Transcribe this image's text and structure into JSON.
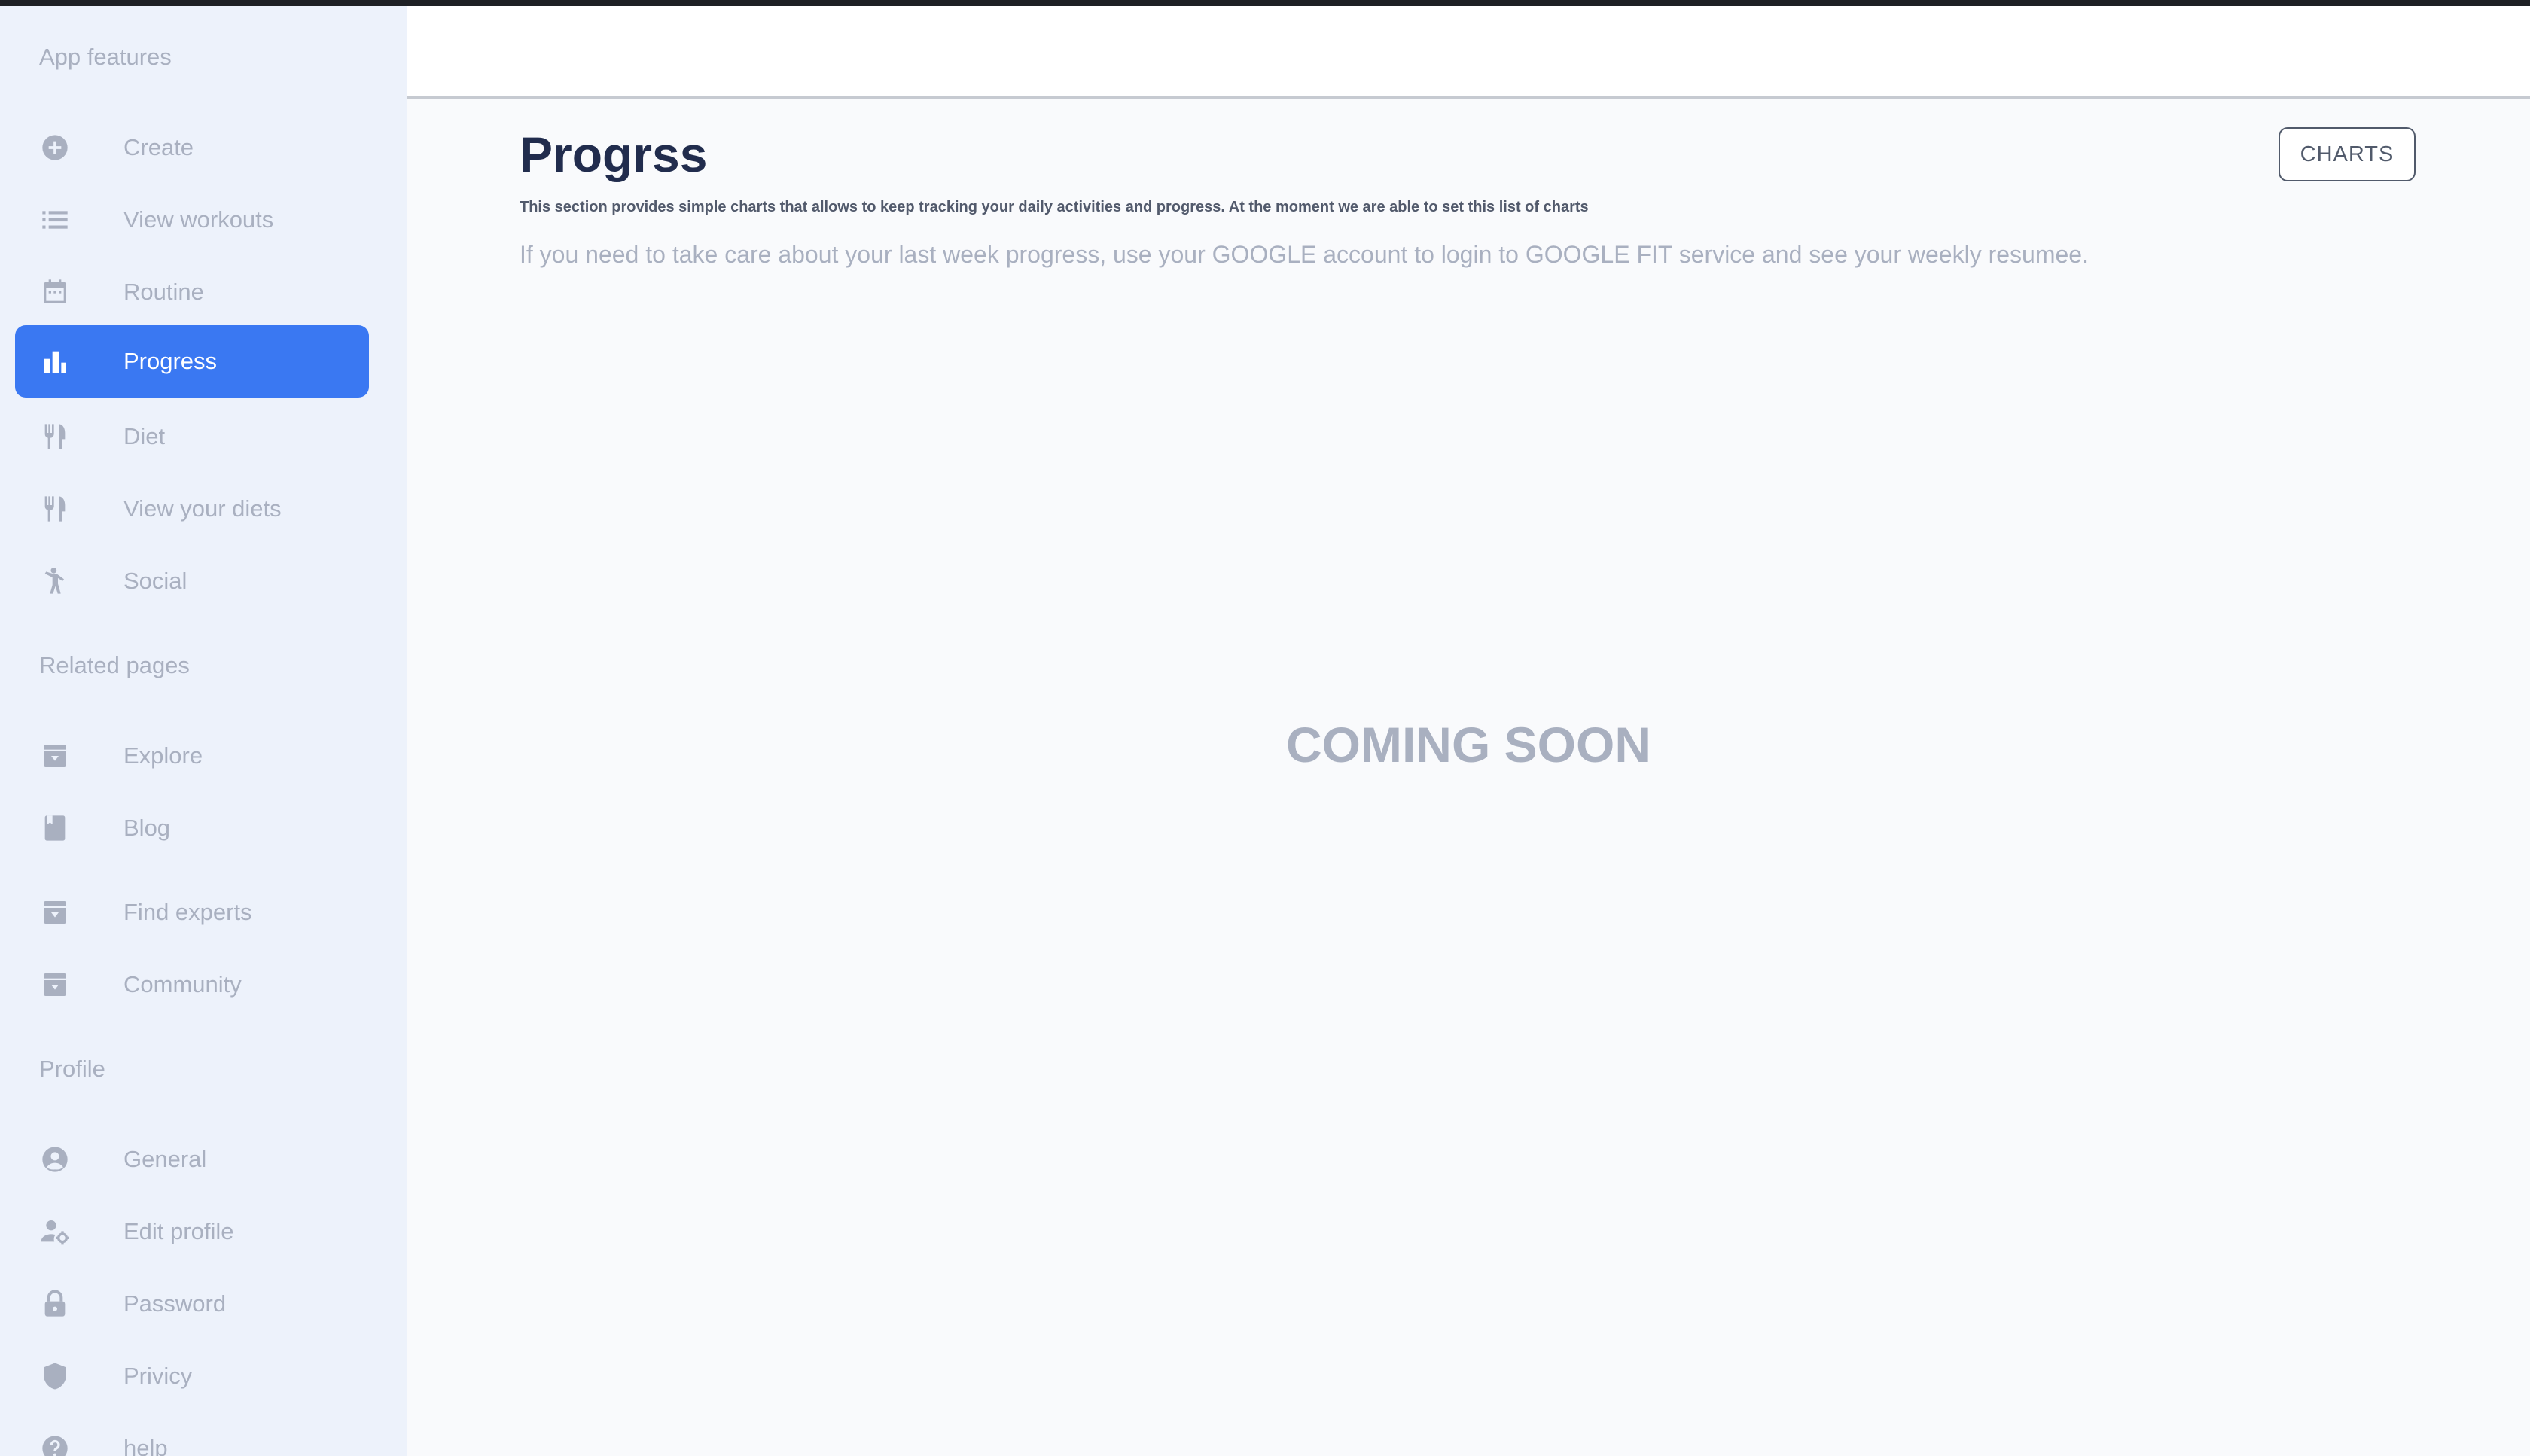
{
  "sidebar": {
    "sections": [
      {
        "title": "App features"
      },
      {
        "title": "Related pages"
      },
      {
        "title": "Profile"
      }
    ],
    "app_features": [
      {
        "label": "Create",
        "icon": "add-circle-icon"
      },
      {
        "label": "View workouts",
        "icon": "list-icon"
      },
      {
        "label": "Routine",
        "icon": "calendar-icon"
      },
      {
        "label": "Progress",
        "icon": "bar-chart-icon",
        "active": true
      },
      {
        "label": "Diet",
        "icon": "restaurant-icon"
      },
      {
        "label": "View your diets",
        "icon": "restaurant-icon"
      },
      {
        "label": "Social",
        "icon": "person-walking-icon"
      }
    ],
    "related_pages": [
      {
        "label": "Explore",
        "icon": "archive-icon"
      },
      {
        "label": "Blog",
        "icon": "book-icon"
      },
      {
        "label": "Find experts",
        "icon": "archive-icon"
      },
      {
        "label": "Community",
        "icon": "archive-icon"
      }
    ],
    "profile": [
      {
        "label": "General",
        "icon": "account-circle-icon"
      },
      {
        "label": "Edit profile",
        "icon": "person-settings-icon"
      },
      {
        "label": "Password",
        "icon": "lock-icon"
      },
      {
        "label": "Privicy",
        "icon": "shield-icon"
      },
      {
        "label": "help",
        "icon": "help-icon"
      }
    ]
  },
  "main": {
    "title": "Progrss",
    "subtitle": "This section provides simple charts that allows to keep tracking your daily activities and progress. At the moment we are able to set this list of charts",
    "info": "If you need to take care about your last week progress, use your GOOGLE account to login to GOOGLE FIT service and see your weekly resumee.",
    "charts_button": "CHARTS",
    "coming_soon": "COMING SOON"
  },
  "colors": {
    "accent": "#3a78f2",
    "sidebar_bg": "#edf2fb",
    "muted_text": "#a9b0c0",
    "title_text": "#212c4d",
    "page_bg": "#f9fafc"
  }
}
